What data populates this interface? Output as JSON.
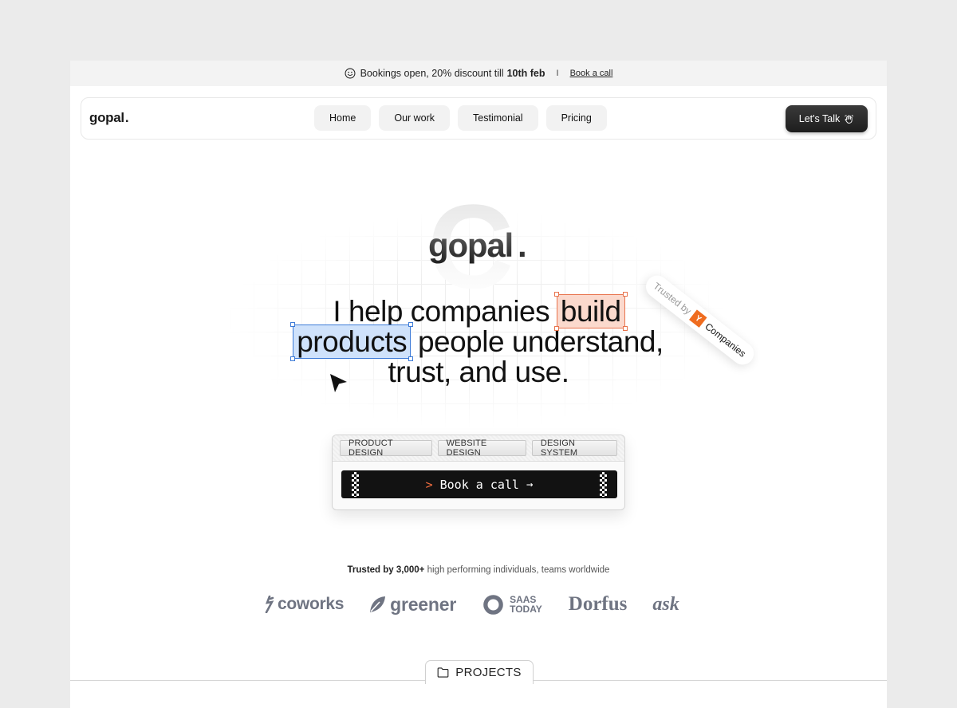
{
  "announcement": {
    "text": "Bookings open, 20% discount till",
    "highlight": "10th feb",
    "separator": "I",
    "link": "Book a call"
  },
  "nav": {
    "logo": "gopal",
    "logo_dot": ".",
    "links": [
      "Home",
      "Our work",
      "Testimonial",
      "Pricing"
    ],
    "cta": "Let's Talk"
  },
  "hero": {
    "logo": "gopal",
    "logo_dot": ".",
    "badge": {
      "prefix": "Trusted by",
      "yc_letter": "Y",
      "suffix": "Companies"
    },
    "headline": {
      "part1": "I help companies",
      "highlight_orange": "build",
      "highlight_blue": "products",
      "part2": "people understand,",
      "part3": "trust, and use."
    }
  },
  "cta": {
    "tags": [
      "PRODUCT DESIGN",
      "WEBSITE DESIGN",
      "DESIGN SYSTEM"
    ],
    "prompt": ">",
    "button": "Book a call",
    "arrow": "→"
  },
  "trusted": {
    "bold": "Trusted by 3,000+",
    "rest": "high performing individuals, teams worldwide"
  },
  "brands": {
    "coworks": "coworks",
    "greener": "greener",
    "saas_line1": "SAAS",
    "saas_line2": "TODAY",
    "dorfus": "Dorfus",
    "ask": "ask"
  },
  "projects": {
    "label": "PROJECTS"
  },
  "colors": {
    "accent_orange": "#ef6c3f",
    "highlight_orange": "#fbd9cd",
    "highlight_blue": "#cfe2fb",
    "brand_gray": "#6f7482",
    "yc_orange": "#ef6c1f"
  },
  "icons": {
    "announcement": "smiley-icon",
    "cta": "waving-hand-icon",
    "cursor": "cursor-arrow-icon",
    "projects": "folder-icon"
  }
}
